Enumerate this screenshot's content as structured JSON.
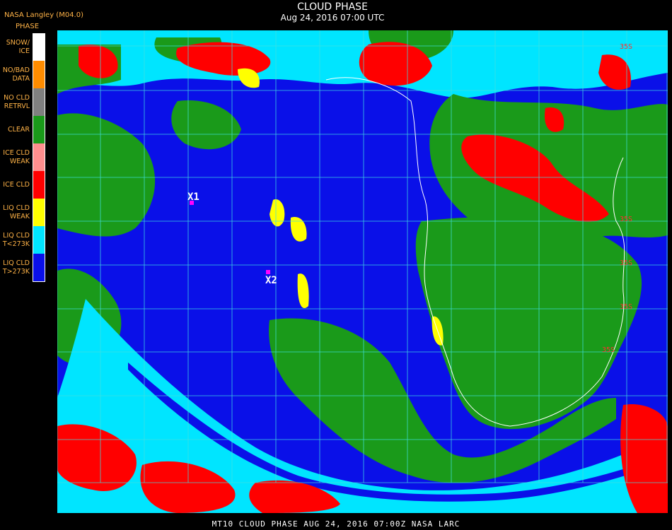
{
  "header": {
    "title": "CLOUD PHASE",
    "subtitle": "Aug 24, 2016 07:00 UTC",
    "provider": "NASA Langley (M04.0)",
    "legend_title": "PHASE"
  },
  "legend": [
    {
      "label": "SNOW/\nICE",
      "color": "#ffffff"
    },
    {
      "label": "NO/BAD\nDATA",
      "color": "#ff8c00"
    },
    {
      "label": "NO CLD\nRETRVL",
      "color": "#808080"
    },
    {
      "label": "CLEAR",
      "color": "#1a9a1a"
    },
    {
      "label": "ICE CLD\nWEAK",
      "color": "#ff8f8f"
    },
    {
      "label": "ICE CLD",
      "color": "#ff0000"
    },
    {
      "label": "LIQ CLD\nWEAK",
      "color": "#ffff00"
    },
    {
      "label": "LIQ CLD\nT<273K",
      "color": "#00e5ff"
    },
    {
      "label": "LIQ CLD\nT>273K",
      "color": "#0a10e8"
    }
  ],
  "markers": [
    {
      "label": "X1",
      "color": "#ff00ff"
    },
    {
      "label": "X2",
      "color": "#ff00ff"
    }
  ],
  "grid_labels": [
    "35S",
    "35S",
    "35S",
    "35S",
    "35S"
  ],
  "footer": "MT10  CLOUD PHASE   AUG 24, 2016 07:00Z   NASA LARC"
}
